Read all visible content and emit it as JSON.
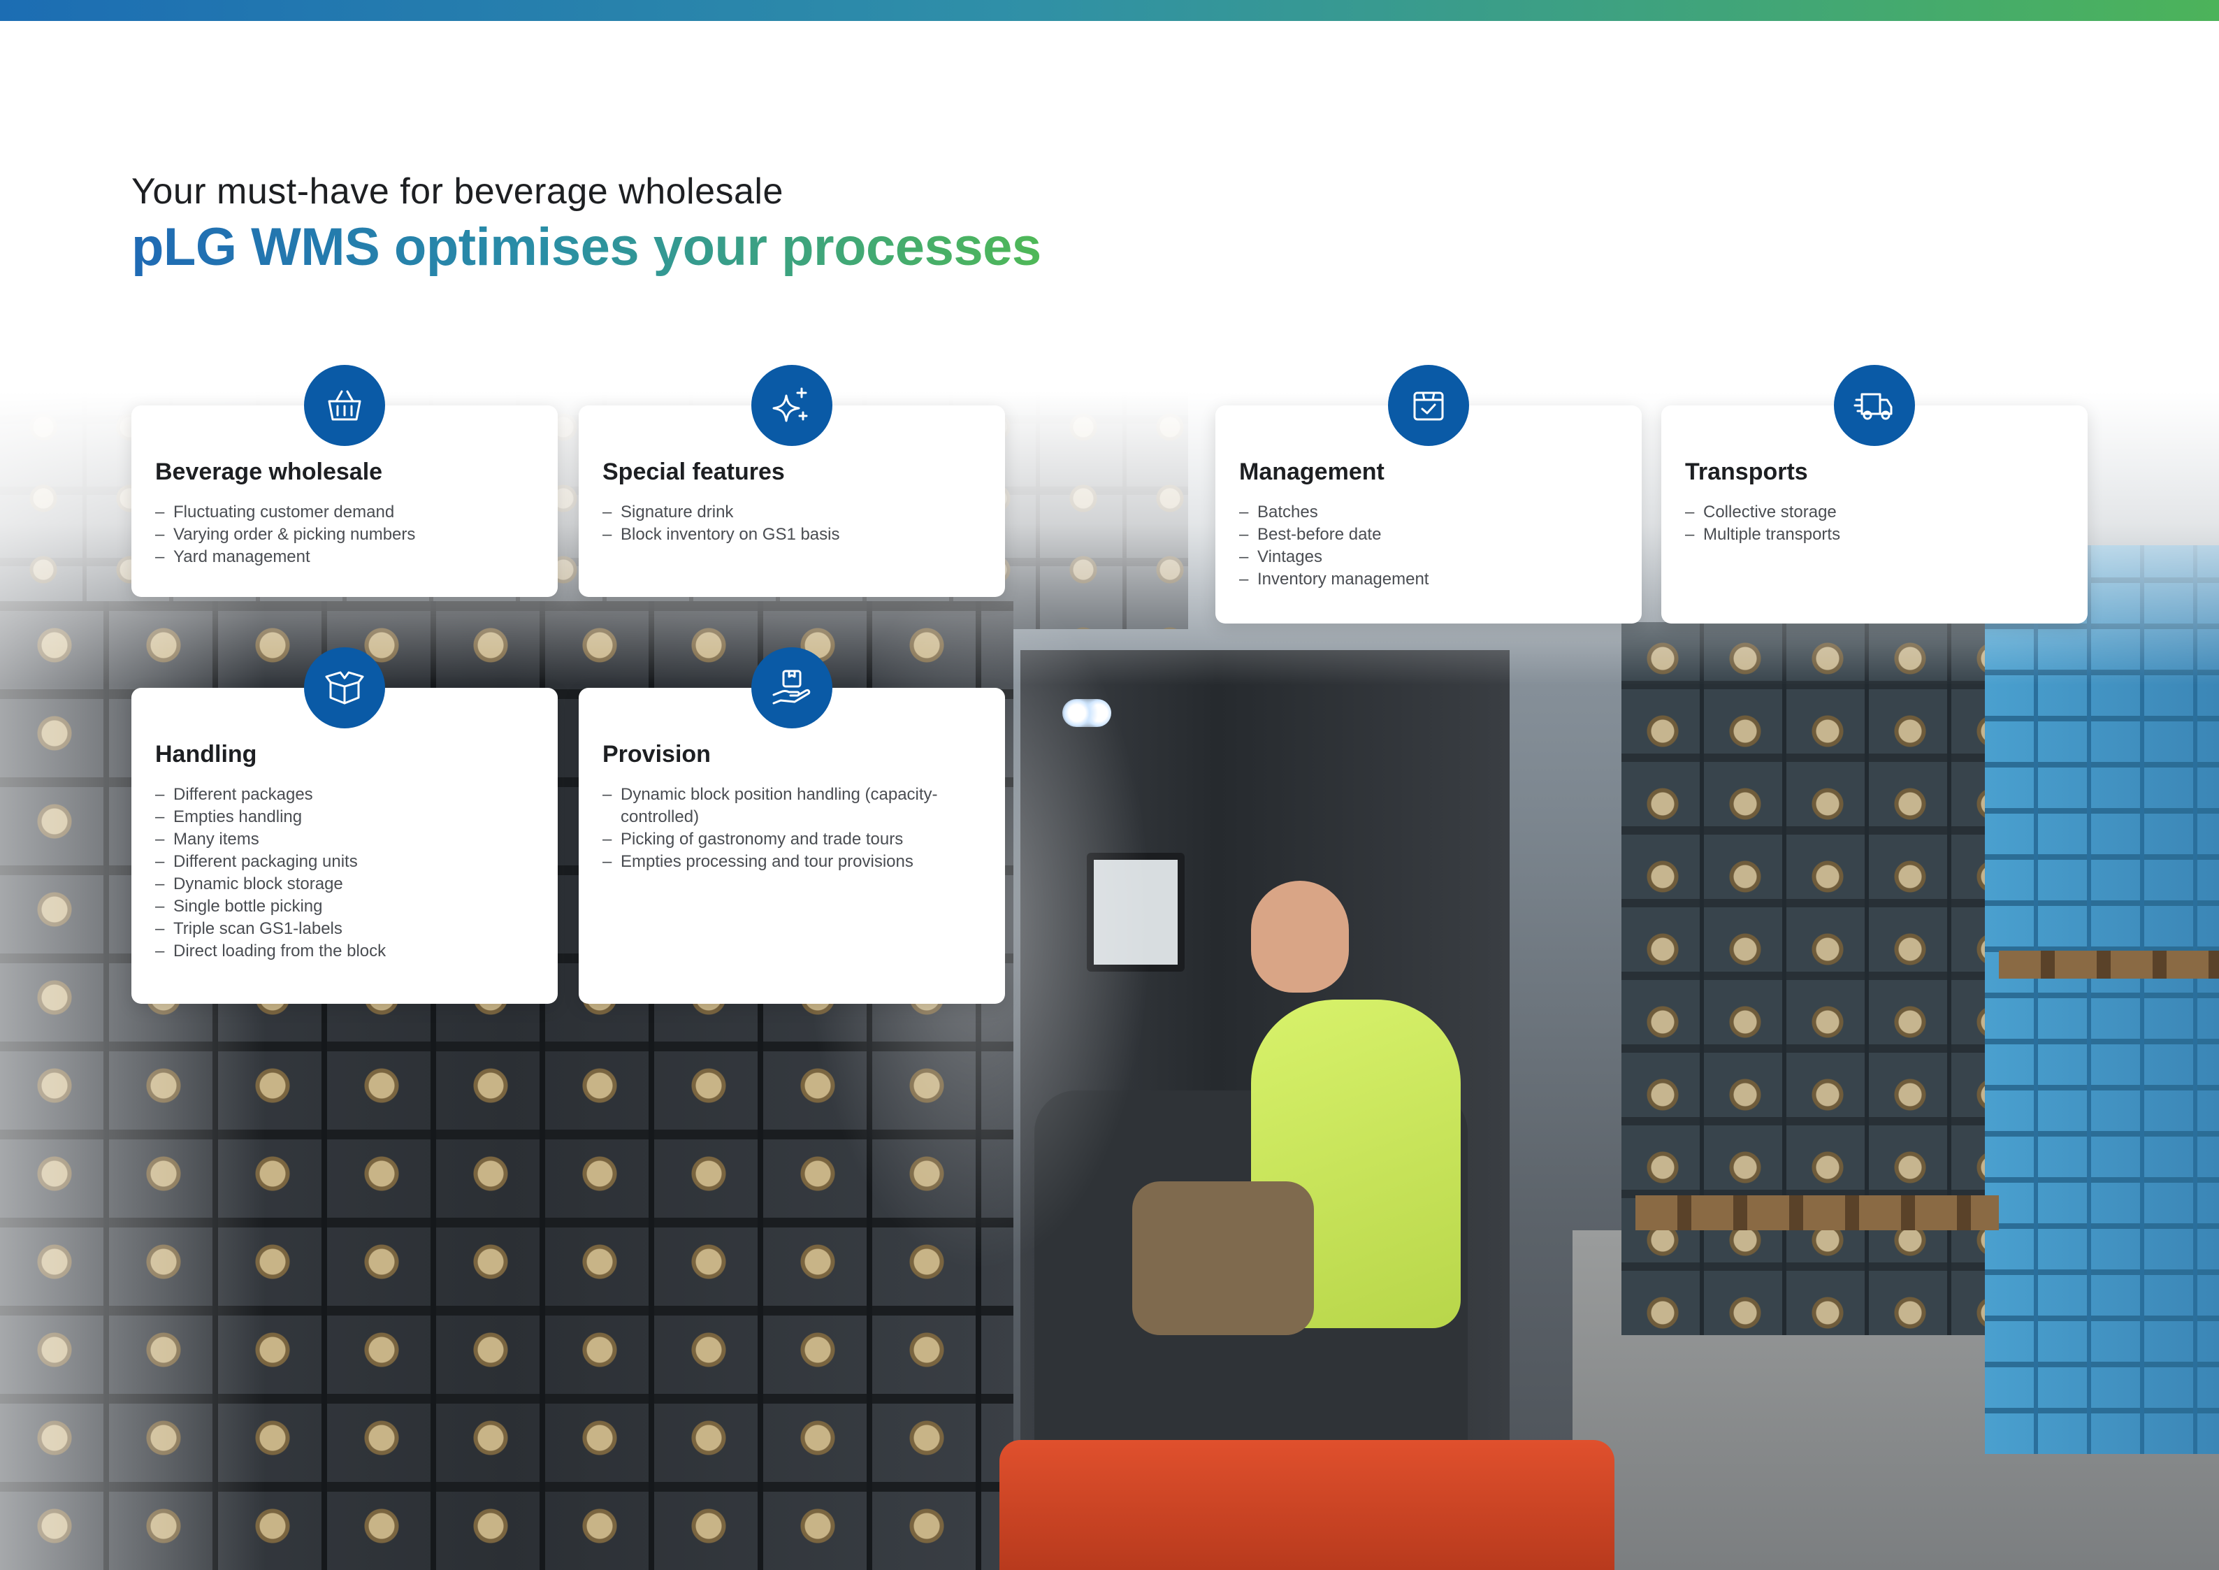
{
  "header": {
    "subtitle": "Your must-have for beverage wholesale",
    "title": "pLG WMS optimises your processes"
  },
  "colors": {
    "brand_blue": "#0a5aa6",
    "gradient_start": "#1f6ab4",
    "gradient_end": "#4fb857"
  },
  "cards": [
    {
      "icon": "basket-icon",
      "title": "Beverage wholesale",
      "items": [
        "Fluctuating customer demand",
        "Varying order & picking numbers",
        "Yard management"
      ]
    },
    {
      "icon": "sparkles-icon",
      "title": "Special features",
      "items": [
        "Signature drink",
        "Block inventory on GS1 basis"
      ]
    },
    {
      "icon": "box-check-icon",
      "title": "Management",
      "items": [
        "Batches",
        "Best-before date",
        "Vintages",
        "Inventory management"
      ]
    },
    {
      "icon": "truck-icon",
      "title": "Transports",
      "items": [
        "Collective storage",
        "Multiple transports"
      ]
    },
    {
      "icon": "open-box-icon",
      "title": "Handling",
      "items": [
        "Different packages",
        "Empties handling",
        "Many items",
        "Different packaging units",
        "Dynamic block storage",
        "Single bottle picking",
        "Triple scan GS1-labels",
        "Direct loading from the block"
      ]
    },
    {
      "icon": "hand-box-icon",
      "title": "Provision",
      "items": [
        "Dynamic block position handling (capacity-controlled)",
        "Picking of gastronomy and trade tours",
        "Empties processing and tour provisions"
      ]
    }
  ],
  "list_dash": "–"
}
